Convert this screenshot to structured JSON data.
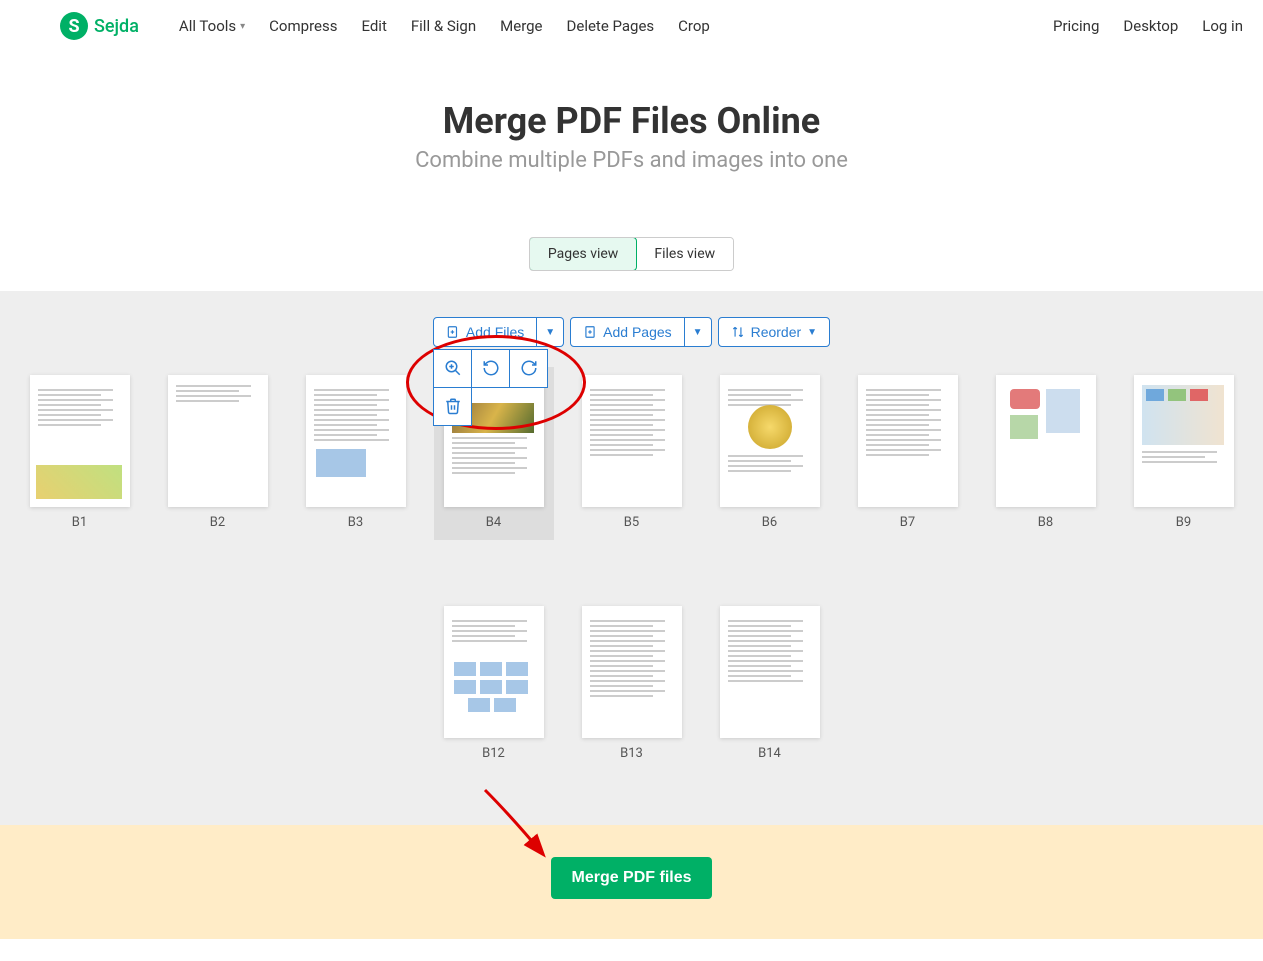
{
  "brand": {
    "name": "Sejda",
    "initial": "S"
  },
  "nav": {
    "left": [
      "All Tools",
      "Compress",
      "Edit",
      "Fill & Sign",
      "Merge",
      "Delete Pages",
      "Crop"
    ],
    "right": [
      "Pricing",
      "Desktop",
      "Log in"
    ]
  },
  "page": {
    "title": "Merge PDF Files Online",
    "subtitle": "Combine multiple PDFs and images into one"
  },
  "view_toggle": {
    "pages": "Pages view",
    "files": "Files view",
    "active": "pages"
  },
  "toolbar": {
    "add_files": "Add Files",
    "add_pages": "Add Pages",
    "reorder": "Reorder"
  },
  "thumbs": [
    {
      "label": "B1"
    },
    {
      "label": "B2"
    },
    {
      "label": "B3"
    },
    {
      "label": "B4",
      "selected": true
    },
    {
      "label": "B5"
    },
    {
      "label": "B6"
    },
    {
      "label": "B7"
    },
    {
      "label": "B8"
    },
    {
      "label": "B9"
    },
    {
      "label": "B12"
    },
    {
      "label": "B13"
    },
    {
      "label": "B14"
    }
  ],
  "page_tools": {
    "zoom": "zoom",
    "rotate_ccw": "rotate-ccw",
    "rotate_cw": "rotate-cw",
    "delete": "delete"
  },
  "merge_button": "Merge PDF files"
}
